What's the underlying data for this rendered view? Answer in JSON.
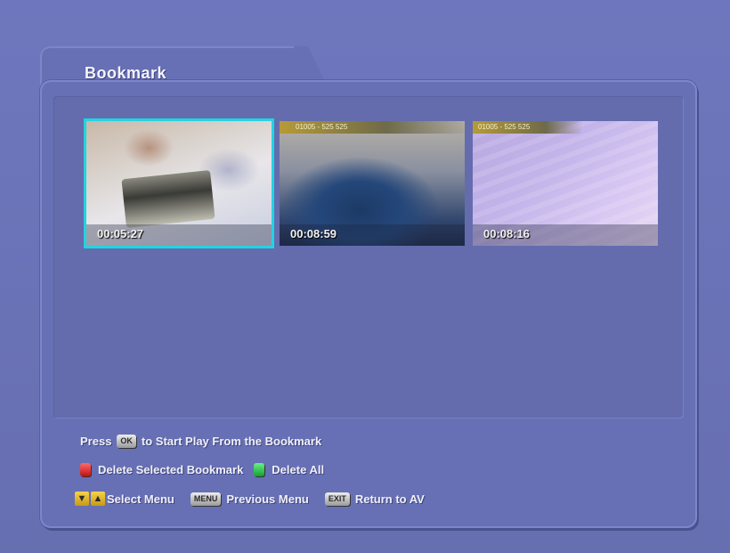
{
  "panel": {
    "title": "Bookmark"
  },
  "bookmarks": [
    {
      "time": "00:05:27",
      "selected": true
    },
    {
      "time": "00:08:59",
      "banner": "01005 - 525 525",
      "selected": false
    },
    {
      "time": "00:08:16",
      "banner": "01005 - 525 525",
      "selected": false
    }
  ],
  "help": {
    "press": "Press",
    "ok_key": "OK",
    "start_play": "to Start Play From the Bookmark",
    "delete_selected": "Delete Selected Bookmark",
    "delete_all": "Delete All",
    "select_menu": "Select Menu",
    "menu_key": "MENU",
    "previous_menu": "Previous Menu",
    "exit_key": "EXIT",
    "return_av": "Return to AV"
  },
  "colors": {
    "background": "#6b74b8",
    "selection": "#22d4e0",
    "red_key": "#e02020",
    "green_key": "#20c040",
    "yellow_key": "#f6d24a"
  },
  "icons": [
    "down-arrow-icon",
    "up-arrow-icon"
  ]
}
